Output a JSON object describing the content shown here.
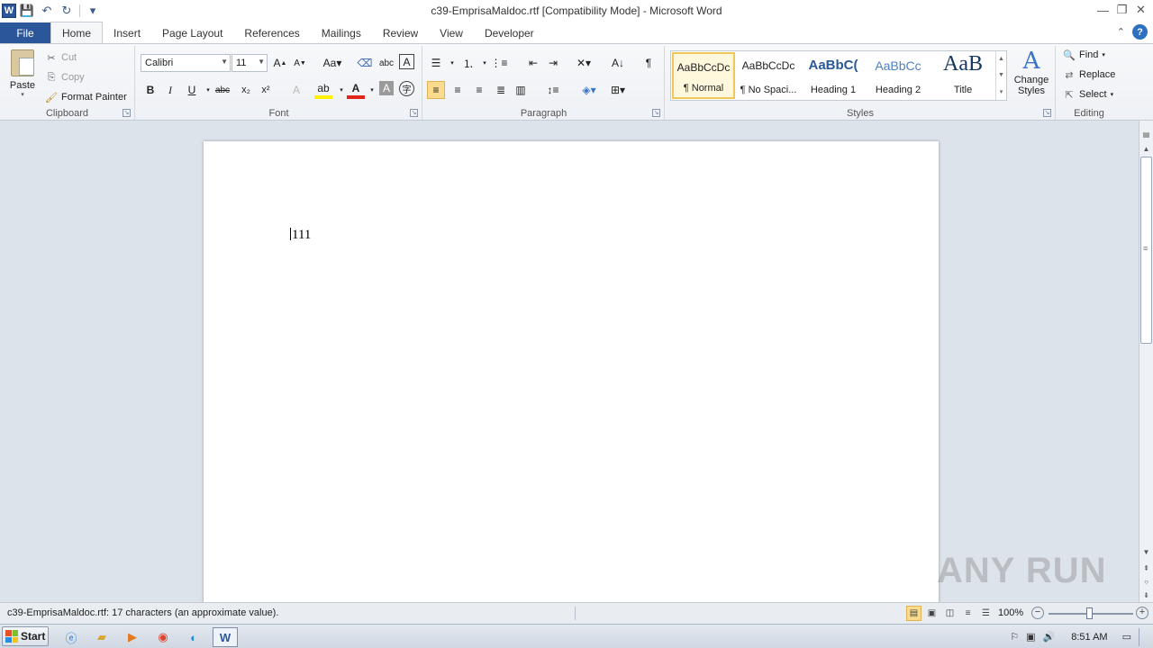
{
  "window": {
    "title": "c39-EmprisaMaldoc.rtf [Compatibility Mode]  -  Microsoft Word"
  },
  "qat": {
    "logo": "W"
  },
  "tabs": [
    {
      "label": "File"
    },
    {
      "label": "Home"
    },
    {
      "label": "Insert"
    },
    {
      "label": "Page Layout"
    },
    {
      "label": "References"
    },
    {
      "label": "Mailings"
    },
    {
      "label": "Review"
    },
    {
      "label": "View"
    },
    {
      "label": "Developer"
    }
  ],
  "clipboard": {
    "paste": "Paste",
    "cut": "Cut",
    "copy": "Copy",
    "format_painter": "Format Painter",
    "label": "Clipboard"
  },
  "font": {
    "name": "Calibri",
    "size": "11",
    "label": "Font"
  },
  "paragraph": {
    "label": "Paragraph"
  },
  "styles": {
    "items": [
      {
        "sample": "AaBbCcDc",
        "name": "¶ Normal"
      },
      {
        "sample": "AaBbCcDc",
        "name": "¶ No Spaci..."
      },
      {
        "sample": "AaBbC(",
        "name": "Heading 1"
      },
      {
        "sample": "AaBbCc",
        "name": "Heading 2"
      },
      {
        "sample": "AaB",
        "name": "Title"
      }
    ],
    "change_styles": "Change Styles",
    "label": "Styles"
  },
  "editing": {
    "find": "Find",
    "replace": "Replace",
    "select": "Select",
    "label": "Editing"
  },
  "document": {
    "text": "111"
  },
  "watermark": "ANY RUN",
  "statusbar": {
    "info": "c39-EmprisaMaldoc.rtf: 17 characters (an approximate value).",
    "zoom": "100%"
  },
  "taskbar": {
    "start": "Start",
    "time": "8:51 AM"
  },
  "colors": {
    "accent": "#2b579a",
    "selected_style": "#f2c75a"
  }
}
